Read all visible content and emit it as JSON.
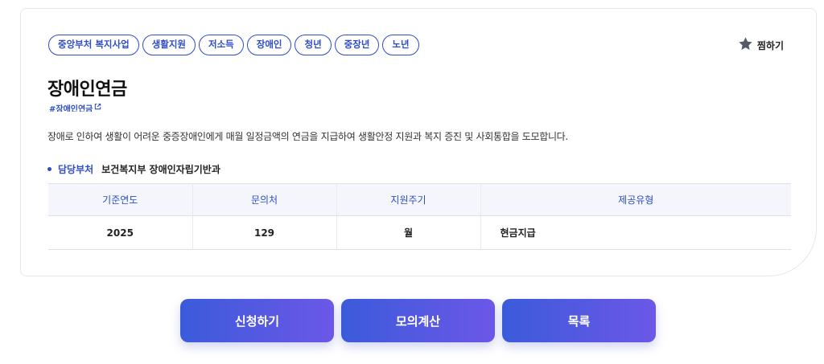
{
  "tags": [
    "중앙부처 복지사업",
    "생활지원",
    "저소득",
    "장애인",
    "청년",
    "중장년",
    "노년"
  ],
  "favorite": {
    "label": "찜하기",
    "icon": "star-icon"
  },
  "title": "장애인연금",
  "hashtag": {
    "label": "#장애인연금",
    "icon": "external-link-icon"
  },
  "description": "장애로 인하여 생활이 어려운 중증장애인에게 매월 일정금액의 연금을 지급하여 생활안정 지원과 복지 증진 및 사회통합을 도모합니다.",
  "department": {
    "label": "담당부처",
    "value": "보건복지부 장애인자립기반과"
  },
  "table": {
    "headers": [
      "기준연도",
      "문의처",
      "지원주기",
      "제공유형"
    ],
    "row": [
      "2025",
      "129",
      "월",
      "현금지급"
    ]
  },
  "buttons": {
    "apply": "신청하기",
    "simulate": "모의계산",
    "list": "목록"
  },
  "colors": {
    "accent": "#2f4dc4",
    "button_start": "#3b5bdb",
    "button_end": "#6c57e8"
  }
}
